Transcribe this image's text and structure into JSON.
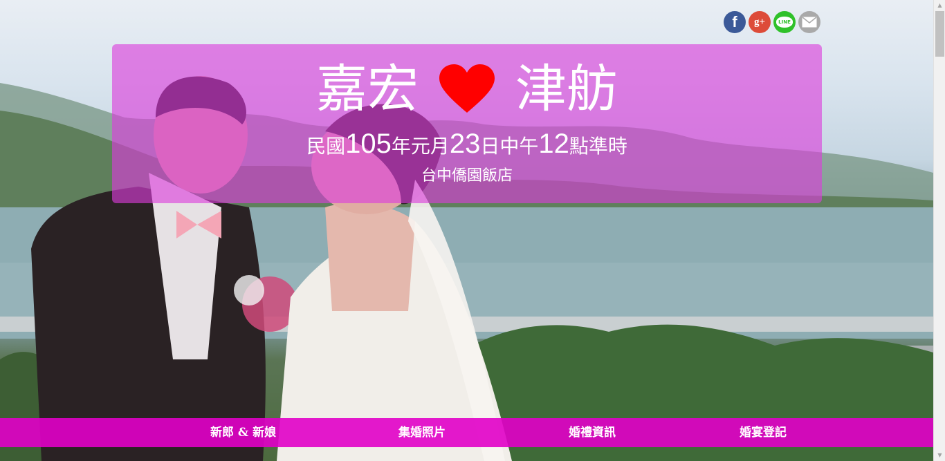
{
  "title": {
    "groom": "嘉宏",
    "bride": "津舫",
    "heart_color": "#ff0000"
  },
  "date": {
    "p1": "民國",
    "year": "105",
    "p2": "年元月",
    "day": "23",
    "p3": "日中午",
    "hour": "12",
    "p4": "點準時"
  },
  "venue": "台中僑園飯店",
  "social": {
    "facebook": "f",
    "googleplus": "g+",
    "line": "LINE"
  },
  "nav": {
    "items": [
      {
        "label": "新郎 & 新娘"
      },
      {
        "label": "集婚照片"
      },
      {
        "label": "婚禮資訊"
      },
      {
        "label": "婚宴登記"
      }
    ]
  },
  "colors": {
    "panel": "#dc3cdc",
    "nav": "#e100c8"
  }
}
